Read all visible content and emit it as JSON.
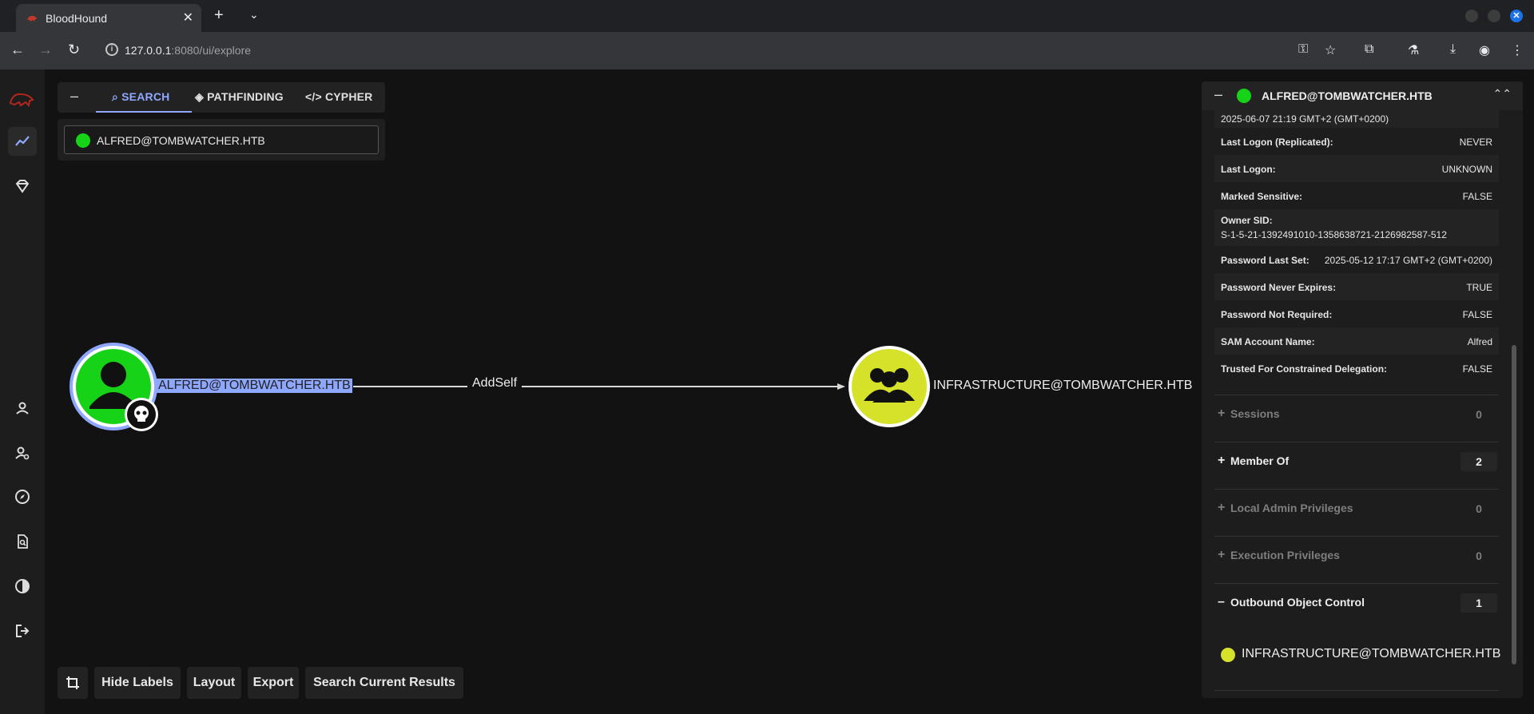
{
  "browser": {
    "tab_title": "BloodHound",
    "tab_close": "✕",
    "new_tab": "+",
    "tab_list": "⌄",
    "url_host": "127.0.0.1",
    "url_path": ":8080/ui/explore"
  },
  "search": {
    "tabs": [
      "SEARCH",
      "PATHFINDING",
      "CYPHER"
    ],
    "active_tab": "SEARCH",
    "minimize": "–",
    "value": "ALFRED@TOMBWATCHER.HTB"
  },
  "graph": {
    "source_label": "ALFRED@TOMBWATCHER.HTB",
    "edge_label": "AddSelf",
    "target_label": "INFRASTRUCTURE@TOMBWATCHER.HTB",
    "source_color": "#17d317",
    "target_color": "#d6e12a"
  },
  "bottom_bar": {
    "hide_labels": "Hide Labels",
    "layout": "Layout",
    "export": "Export",
    "search_results": "Search Current Results"
  },
  "detail": {
    "title": "ALFRED@TOMBWATCHER.HTB",
    "partial_value": "2025-06-07 21:19 GMT+2 (GMT+0200)",
    "props": [
      {
        "k": "Last Logon (Replicated):",
        "v": "NEVER"
      },
      {
        "k": "Last Logon:",
        "v": "UNKNOWN"
      },
      {
        "k": "Marked Sensitive:",
        "v": "FALSE"
      },
      {
        "k": "Owner SID:",
        "v": "S-1-5-21-1392491010-1358638721-2126982587-512"
      },
      {
        "k": "Password Last Set:",
        "v": "2025-05-12 17:17 GMT+2 (GMT+0200)"
      },
      {
        "k": "Password Never Expires:",
        "v": "TRUE"
      },
      {
        "k": "Password Not Required:",
        "v": "FALSE"
      },
      {
        "k": "SAM Account Name:",
        "v": "Alfred"
      },
      {
        "k": "Trusted For Constrained Delegation:",
        "v": "FALSE"
      }
    ],
    "sections": [
      {
        "name": "Sessions",
        "count": "0",
        "sign": "+"
      },
      {
        "name": "Member Of",
        "count": "2",
        "sign": "+"
      },
      {
        "name": "Local Admin Privileges",
        "count": "0",
        "sign": "+"
      },
      {
        "name": "Execution Privileges",
        "count": "0",
        "sign": "+"
      },
      {
        "name": "Outbound Object Control",
        "count": "1",
        "sign": "–"
      }
    ],
    "outbound_item": "INFRASTRUCTURE@TOMBWATCHER.HTB"
  }
}
